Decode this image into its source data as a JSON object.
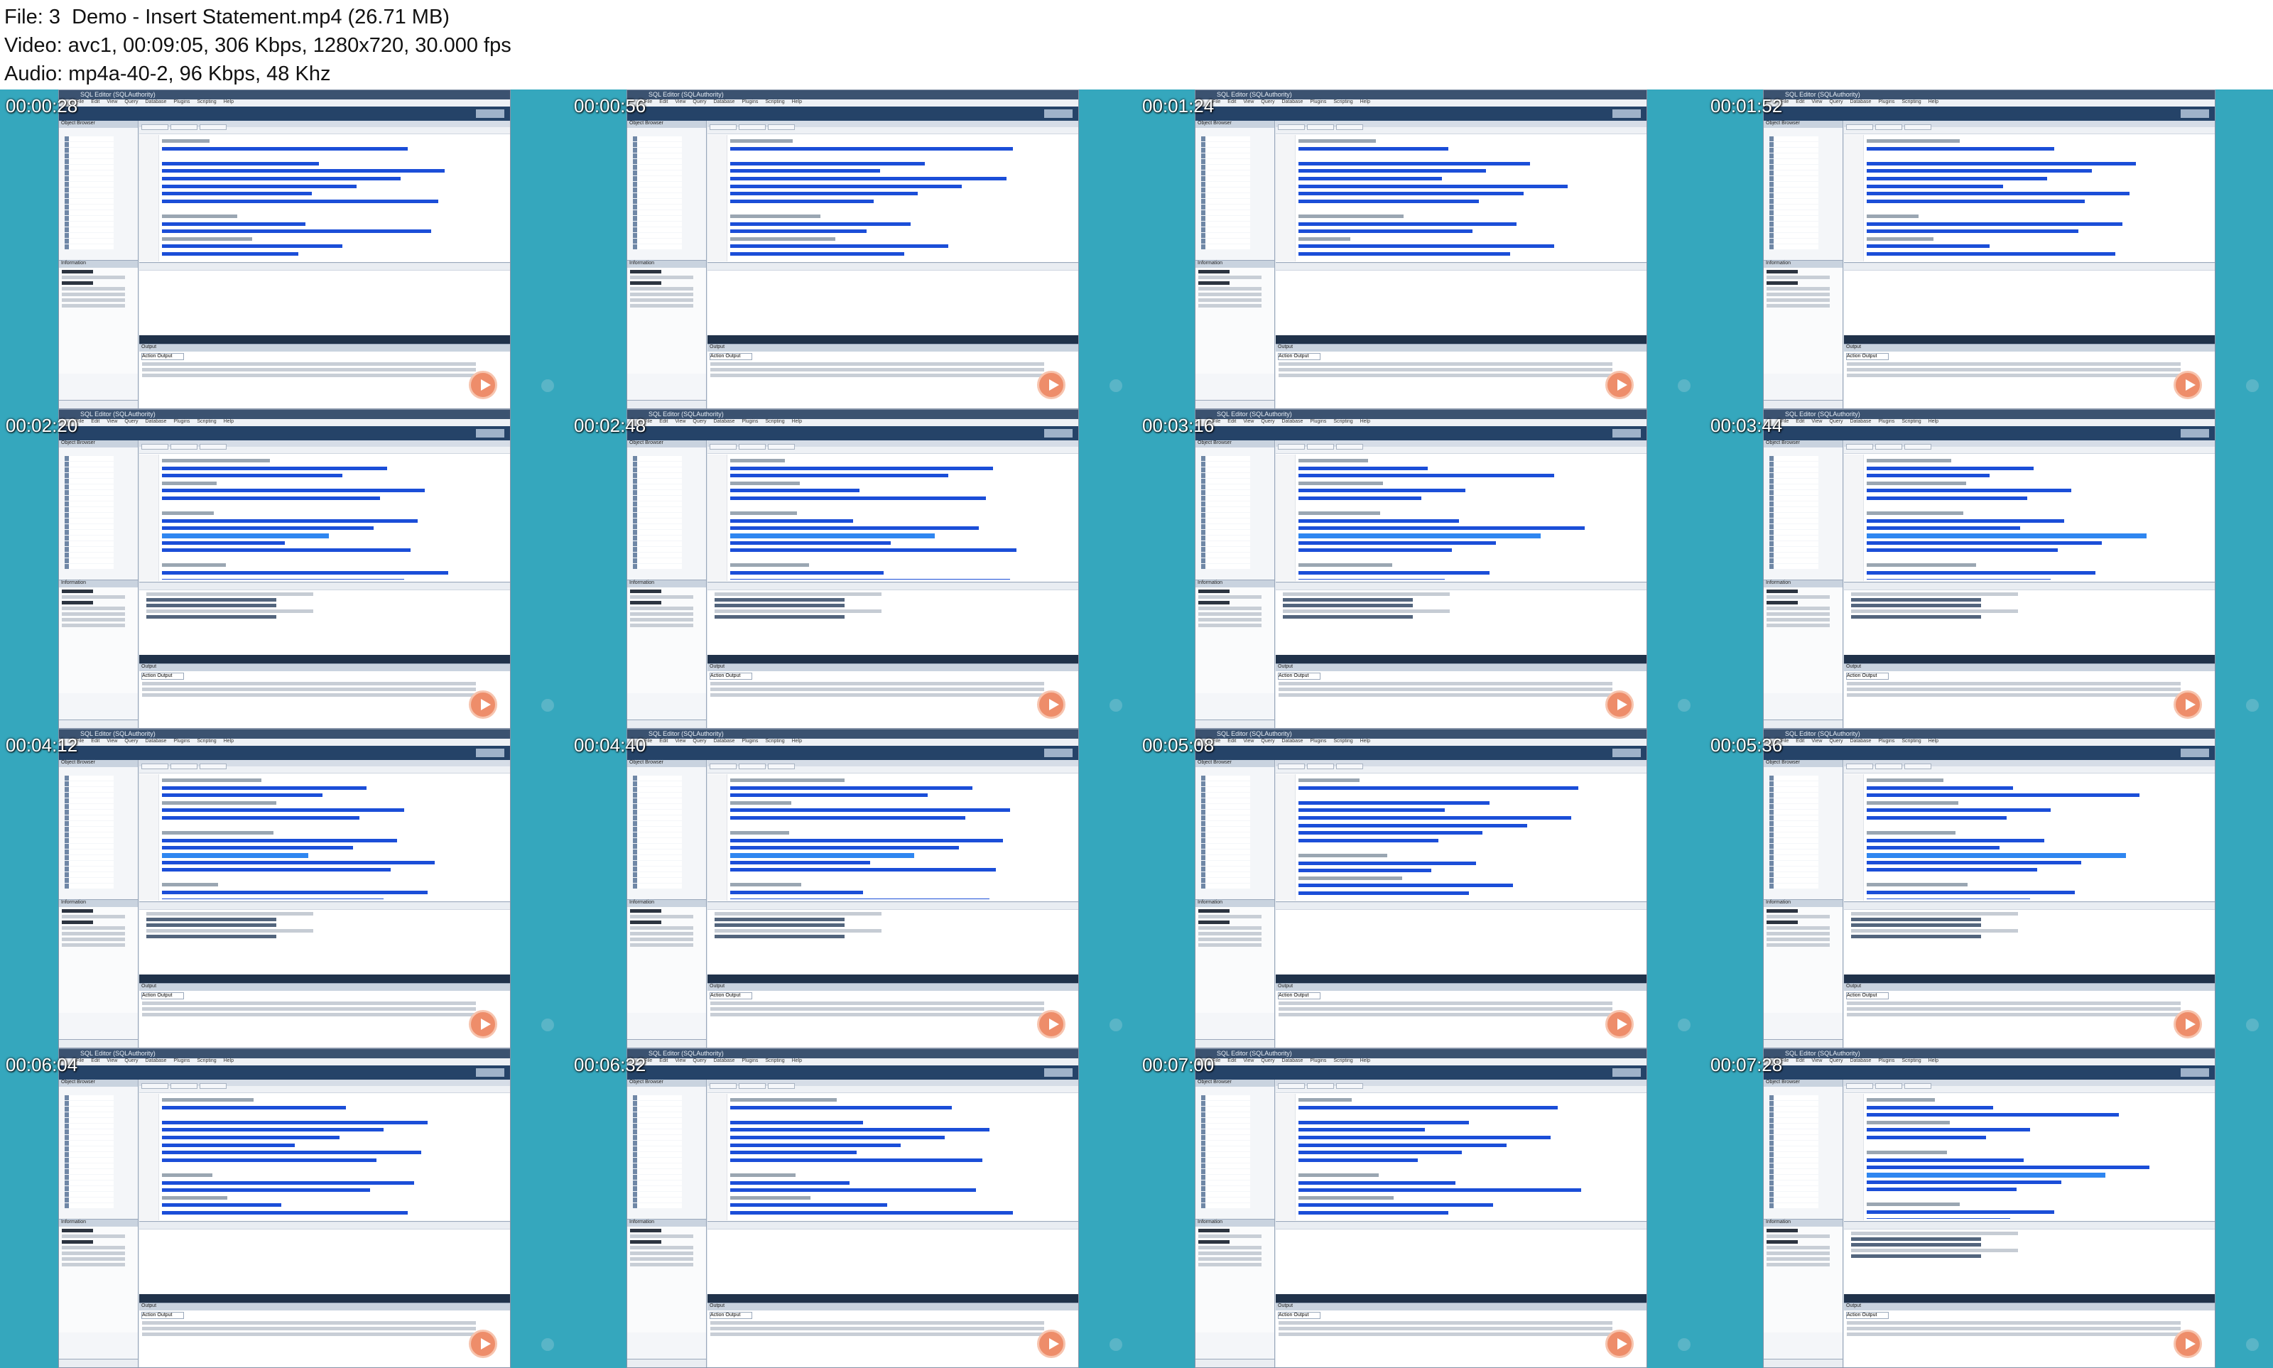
{
  "file_info": {
    "file_line": "File: 3  Demo - Insert Statement.mp4 (26.71 MB)",
    "video_line": "Video: avc1, 00:09:05, 306 Kbps, 1280x720, 30.000 fps",
    "audio_line": "Audio: mp4a-40-2, 96 Kbps, 48 Khz"
  },
  "app": {
    "window_title": "SQL Editor (SQLAuthority)",
    "menu": [
      "File",
      "Edit",
      "View",
      "Query",
      "Database",
      "Plugins",
      "Scripting",
      "Help"
    ],
    "left_panel_title": "Object Browser",
    "info_panel_title": "Information",
    "output_panel_title": "Output",
    "output_selector": "Action Output"
  },
  "frames": [
    {
      "timestamp": "00:00:28",
      "variant": "a"
    },
    {
      "timestamp": "00:00:56",
      "variant": "a"
    },
    {
      "timestamp": "00:01:24",
      "variant": "a"
    },
    {
      "timestamp": "00:01:52",
      "variant": "a"
    },
    {
      "timestamp": "00:02:20",
      "variant": "b"
    },
    {
      "timestamp": "00:02:48",
      "variant": "b"
    },
    {
      "timestamp": "00:03:16",
      "variant": "b"
    },
    {
      "timestamp": "00:03:44",
      "variant": "b"
    },
    {
      "timestamp": "00:04:12",
      "variant": "b"
    },
    {
      "timestamp": "00:04:40",
      "variant": "b"
    },
    {
      "timestamp": "00:05:08",
      "variant": "a"
    },
    {
      "timestamp": "00:05:36",
      "variant": "b"
    },
    {
      "timestamp": "00:06:04",
      "variant": "a"
    },
    {
      "timestamp": "00:06:32",
      "variant": "a"
    },
    {
      "timestamp": "00:07:00",
      "variant": "a"
    },
    {
      "timestamp": "00:07:28",
      "variant": "b"
    }
  ]
}
